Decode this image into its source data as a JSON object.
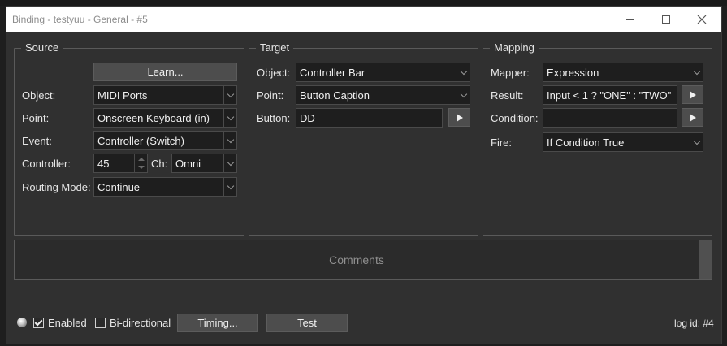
{
  "window": {
    "title": "Binding - testyuu - General - #5"
  },
  "source": {
    "title": "Source",
    "learn_label": "Learn...",
    "object_label": "Object:",
    "object_value": "MIDI Ports",
    "point_label": "Point:",
    "point_value": "Onscreen Keyboard (in)",
    "event_label": "Event:",
    "event_value": "Controller (Switch)",
    "controller_label": "Controller:",
    "controller_value": "45",
    "channel_label": "Ch:",
    "channel_value": "Omni",
    "routing_label": "Routing Mode:",
    "routing_value": "Continue"
  },
  "target": {
    "title": "Target",
    "object_label": "Object:",
    "object_value": "Controller Bar",
    "point_label": "Point:",
    "point_value": "Button Caption",
    "button_label": "Button:",
    "button_value": "DD"
  },
  "mapping": {
    "title": "Mapping",
    "mapper_label": "Mapper:",
    "mapper_value": "Expression",
    "result_label": "Result:",
    "result_value": "Input  < 1 ? \"ONE\" : \"TWO\"",
    "condition_label": "Condition:",
    "condition_value": "",
    "fire_label": "Fire:",
    "fire_value": "If Condition True"
  },
  "comments": {
    "placeholder": "Comments"
  },
  "footer": {
    "enabled_label": "Enabled",
    "enabled_checked": true,
    "bidirectional_label": "Bi-directional",
    "bidirectional_checked": false,
    "timing_label": "Timing...",
    "test_label": "Test",
    "log_id": "log id: #4"
  }
}
